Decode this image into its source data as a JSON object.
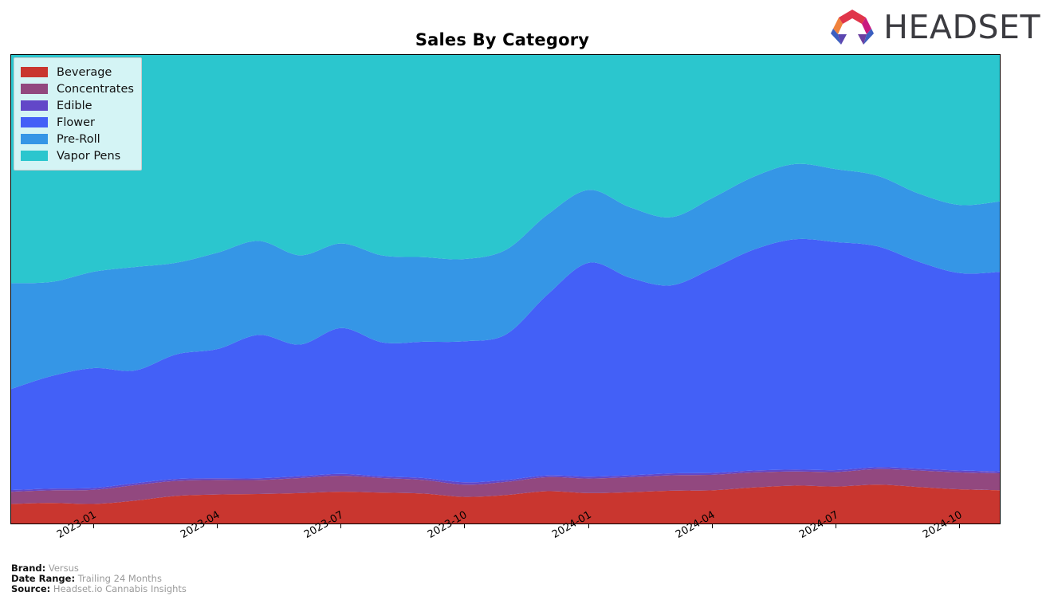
{
  "header": {
    "title": "Sales By Category",
    "logo_text": "HEADSET",
    "logo_colors": [
      "#f0823c",
      "#e0354a",
      "#c9197f",
      "#6b3fa0",
      "#3b5fc0"
    ]
  },
  "footer": {
    "brand_key": "Brand:",
    "brand_value": "Versus",
    "date_range_key": "Date Range:",
    "date_range_value": "Trailing 24 Months",
    "source_key": "Source:",
    "source_value": "Headset.io Cannabis Insights"
  },
  "legend": {
    "position": "upper-left",
    "items": [
      {
        "label": "Beverage",
        "color": "#c9362f"
      },
      {
        "label": "Concentrates",
        "color": "#92487f"
      },
      {
        "label": "Edible",
        "color": "#6247c8"
      },
      {
        "label": "Flower",
        "color": "#4360f7"
      },
      {
        "label": "Pre-Roll",
        "color": "#3596e6"
      },
      {
        "label": "Vapor Pens",
        "color": "#2bc6ce"
      }
    ]
  },
  "chart_data": {
    "type": "area",
    "stacked": true,
    "smoothing": "spline",
    "title": "Sales By Category",
    "xlabel": "",
    "ylabel": "",
    "grid": false,
    "legend_position": "upper-left",
    "x": [
      "2022-11",
      "2022-12",
      "2023-01",
      "2023-02",
      "2023-03",
      "2023-04",
      "2023-05",
      "2023-06",
      "2023-07",
      "2023-08",
      "2023-09",
      "2023-10",
      "2023-11",
      "2023-12",
      "2024-01",
      "2024-02",
      "2024-03",
      "2024-04",
      "2024-05",
      "2024-06",
      "2024-07",
      "2024-08",
      "2024-09",
      "2024-10",
      "2024-11"
    ],
    "tick_labels": [
      "2023-01",
      "2023-04",
      "2023-07",
      "2023-10",
      "2024-01",
      "2024-04",
      "2024-07",
      "2024-10"
    ],
    "ylim": [
      0,
      100
    ],
    "units": "relative sales index",
    "series": [
      {
        "name": "Beverage",
        "color": "#c9362f",
        "values": [
          4.5,
          4.7,
          4.5,
          5.2,
          6.2,
          6.5,
          6.6,
          6.8,
          7.1,
          6.9,
          6.7,
          6.0,
          6.4,
          7.2,
          6.8,
          7.0,
          7.3,
          7.4,
          8.0,
          8.4,
          8.2,
          8.6,
          8.1,
          7.6,
          7.4
        ]
      },
      {
        "name": "Concentrates",
        "color": "#92487f",
        "values": [
          2.6,
          2.7,
          3.0,
          3.3,
          3.2,
          3.1,
          3.0,
          3.2,
          3.4,
          3.1,
          2.9,
          2.6,
          2.8,
          3.0,
          3.1,
          3.2,
          3.3,
          3.3,
          3.2,
          3.0,
          3.1,
          3.3,
          3.5,
          3.6,
          3.6
        ]
      },
      {
        "name": "Edible",
        "color": "#6247c8",
        "values": [
          0.35,
          0.35,
          0.4,
          0.4,
          0.4,
          0.35,
          0.35,
          0.4,
          0.4,
          0.35,
          0.4,
          0.5,
          0.4,
          0.35,
          0.4,
          0.4,
          0.4,
          0.4,
          0.4,
          0.4,
          0.4,
          0.4,
          0.4,
          0.4,
          0.4
        ]
      },
      {
        "name": "Flower",
        "color": "#4360f7",
        "values": [
          21.5,
          24.0,
          25.5,
          24.0,
          26.5,
          27.5,
          30.5,
          28.0,
          31.0,
          28.5,
          29.0,
          30.0,
          31.0,
          38.5,
          45.5,
          42.0,
          40.0,
          43.5,
          47.0,
          49.0,
          48.5,
          47.0,
          44.0,
          42.0,
          42.5
        ]
      },
      {
        "name": "Pre-Roll",
        "color": "#3596e6",
        "values": [
          22.5,
          20.0,
          20.5,
          22.0,
          19.5,
          20.5,
          20.0,
          19.0,
          18.0,
          18.5,
          18.0,
          17.5,
          18.0,
          17.0,
          15.5,
          15.0,
          14.5,
          15.0,
          15.5,
          16.0,
          15.5,
          15.0,
          14.5,
          14.5,
          15.0
        ]
      },
      {
        "name": "Vapor Pens",
        "color": "#2bc6ce",
        "values": [
          52.0,
          53.0,
          50.5,
          52.0,
          55.0,
          53.5,
          51.0,
          55.5,
          50.0,
          52.0,
          47.5,
          44.5,
          48.0,
          56.0,
          63.5,
          56.0,
          52.0,
          55.5,
          58.5,
          57.5,
          61.5,
          55.0,
          50.0,
          46.5,
          44.5
        ]
      }
    ]
  }
}
